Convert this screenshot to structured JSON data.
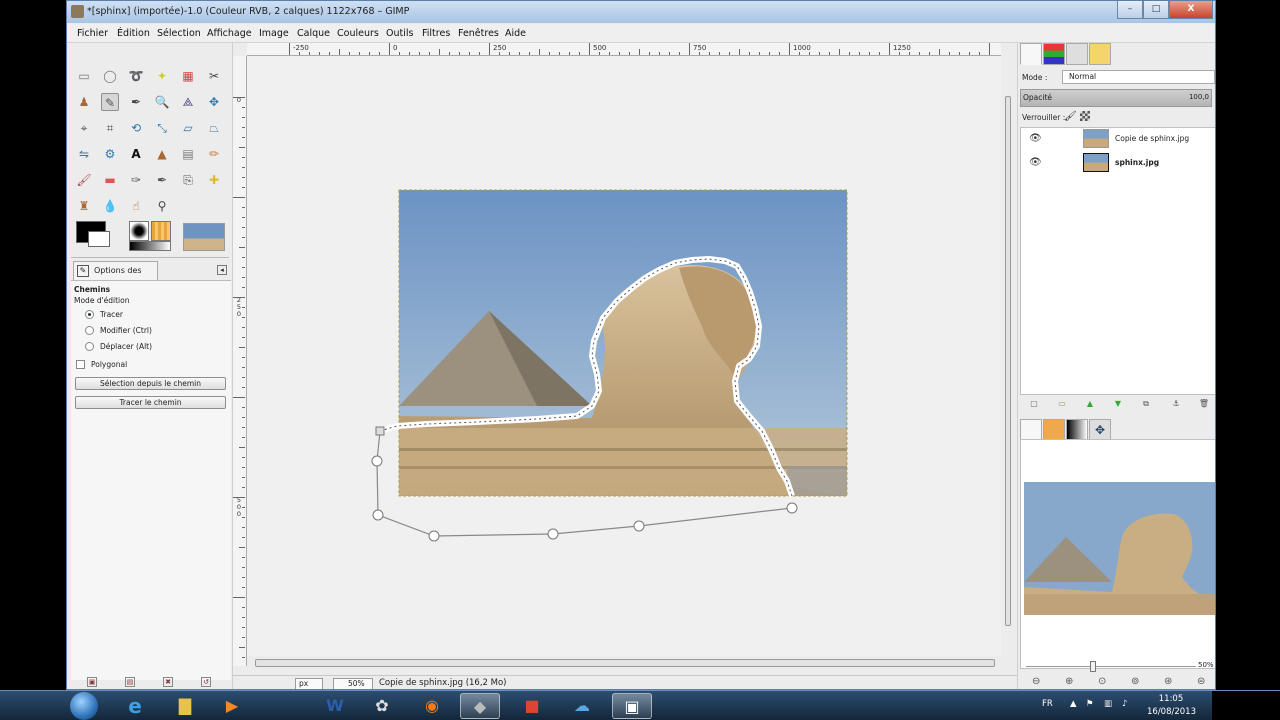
{
  "window": {
    "title": "*[sphinx] (importée)-1.0 (Couleur RVB, 2 calques) 1122x768 – GIMP",
    "minimize": "–",
    "maximize": "□",
    "close": "X"
  },
  "menu": [
    "Fichier",
    "Édition",
    "Sélection",
    "Affichage",
    "Image",
    "Calque",
    "Couleurs",
    "Outils",
    "Filtres",
    "Fenêtres",
    "Aide"
  ],
  "toolbox": {
    "options_tab": "Options des outils",
    "section": "Chemins",
    "edit_mode_label": "Mode d'édition",
    "radios": [
      {
        "label": "Tracer",
        "checked": true
      },
      {
        "label": "Modifier (Ctrl)",
        "checked": false
      },
      {
        "label": "Déplacer (Alt)",
        "checked": false
      }
    ],
    "polygonal": "Polygonal",
    "btn_selection": "Sélection depuis le chemin",
    "btn_stroke": "Tracer le chemin",
    "fg_color": "#000000",
    "bg_color": "#ffffff"
  },
  "rulers": {
    "h_labels": [
      "-250",
      "0",
      "250",
      "500",
      "750",
      "1000",
      "1250"
    ],
    "v_labels": [
      "0",
      "2 5 0",
      "5 0 0",
      "7 5 0"
    ]
  },
  "status": {
    "unit": "px",
    "zoom": "50%",
    "text": "Copie de sphinx.jpg (16,2 Mo)"
  },
  "layers_panel": {
    "mode_label": "Mode :",
    "mode_value": "Normal",
    "opacity_label": "Opacité",
    "opacity_value": "100,0",
    "lock_label": "Verrouiller :",
    "layers": [
      {
        "name": "Copie de sphinx.jpg",
        "selected": false
      },
      {
        "name": "sphinx.jpg",
        "selected": true
      }
    ]
  },
  "navigation": {
    "zoom_percent": "50%"
  },
  "taskbar": {
    "lang": "FR",
    "time": "11:05",
    "date": "16/08/2013"
  },
  "colors": {
    "sky": "#7ea3c9",
    "sand": "#c9ae84",
    "accent_window": "#a9c4e4"
  }
}
